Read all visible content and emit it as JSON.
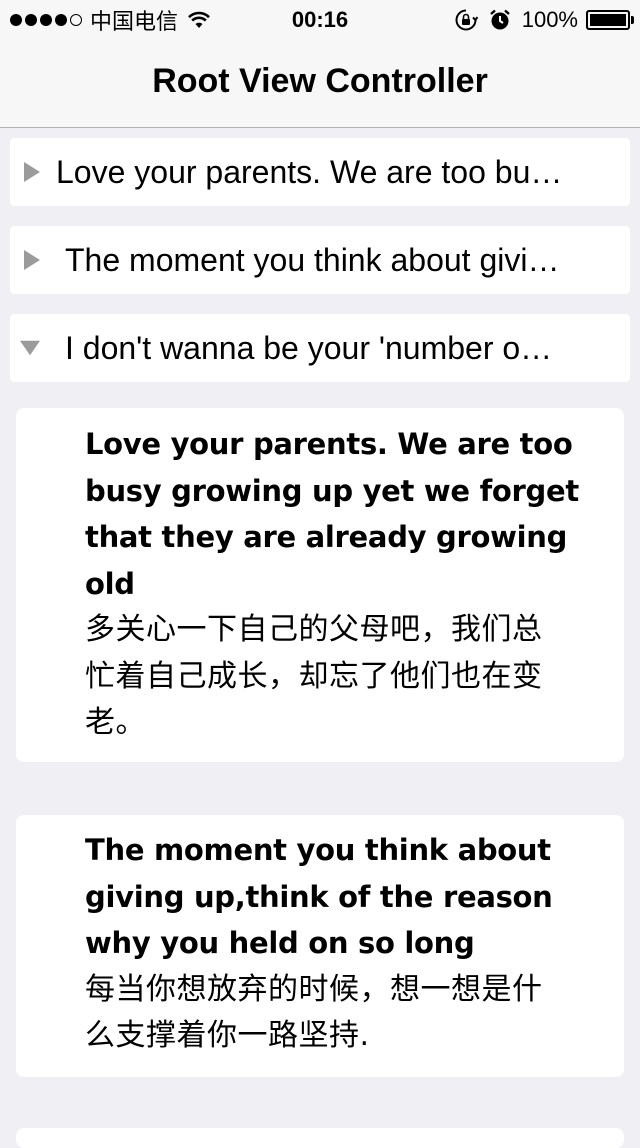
{
  "status_bar": {
    "carrier": "中国电信",
    "time": "00:16",
    "battery_percent": "100%",
    "battery_level": 1.0,
    "signal_bars_filled": 4,
    "signal_bars_total": 5,
    "icons": [
      "signal-dots-icon",
      "wifi-icon",
      "rotation-lock-icon",
      "alarm-icon",
      "battery-icon"
    ]
  },
  "nav": {
    "title": "Root View Controller"
  },
  "rows": [
    {
      "label": "Love your parents. We are too bu…",
      "state": "collapsed",
      "icon": "disclosure-triangle-right-icon"
    },
    {
      "label": "The moment you think about givi…",
      "state": "collapsed",
      "icon": "disclosure-triangle-right-icon"
    },
    {
      "label": "I don't wanna be your 'number o…",
      "state": "expanded",
      "icon": "disclosure-triangle-down-icon"
    }
  ],
  "cards": [
    {
      "english": "Love your parents. We are too\nbusy growing up yet we forget\nthat they are already growing\nold",
      "chinese": "多关心一下自己的父母吧，我们总\n忙着自己成长，却忘了他们也在变\n老。"
    },
    {
      "english": " The moment you think about\ngiving up,think of the reason\nwhy you held on so long",
      "chinese": "每当你想放弃的时候，想一想是什\n么支撑着你一路坚持."
    }
  ],
  "colors": {
    "background": "#efeff4",
    "bar_background": "#f7f7f7",
    "triangle": "#9b9b9b",
    "text": "#000000"
  }
}
